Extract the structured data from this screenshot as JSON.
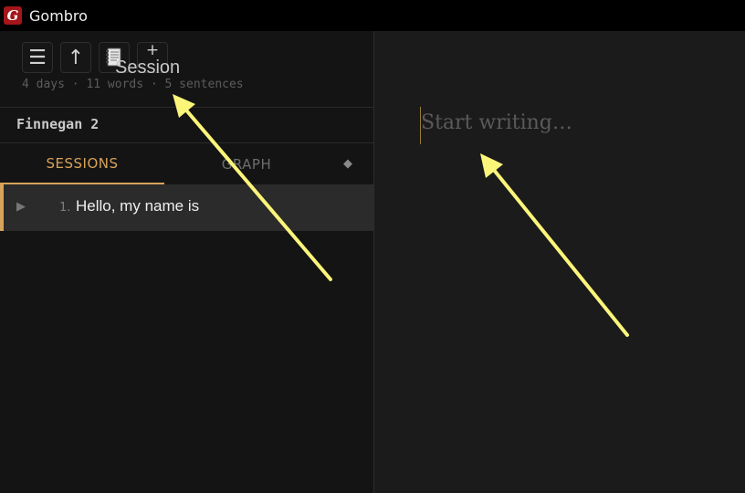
{
  "window": {
    "title": "Gombro",
    "logo_letter": "G"
  },
  "toolbar": {
    "menu_glyph": "☰",
    "up_glyph": "↑",
    "plus_glyph": "+",
    "tooltip": "Session"
  },
  "stats": "4 days · 11 words · 5 sentences",
  "project": {
    "name": "Finnegan 2"
  },
  "tabs": {
    "sessions": "SESSIONS",
    "graph": "GRAPH",
    "extra_glyph": "◆"
  },
  "sessions": [
    {
      "number": "1.",
      "title": "Hello, my name is",
      "caret_glyph": "▶"
    }
  ],
  "editor": {
    "placeholder": "Start writing…"
  },
  "colors": {
    "accent": "#d7a35a",
    "logo": "#a4161a",
    "annotation_arrow": "#fbf57a"
  }
}
